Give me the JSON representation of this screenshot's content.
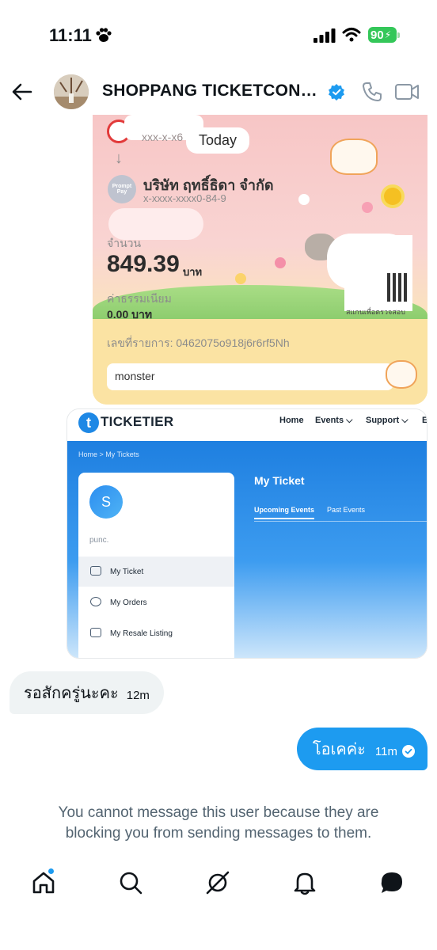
{
  "status_bar": {
    "time": "11:11",
    "battery": "90"
  },
  "header": {
    "name": "SHOPPANG TICKETCONCE..."
  },
  "slip": {
    "today": "Today",
    "account_from": "xxx-x-x6",
    "recipient": "บริษัท ฤทธิ์ธิดา จำกัด",
    "account_to": "x-xxxx-xxxx0-84-9",
    "promptpay": "Prompt Pay",
    "amount_label": "จำนวน",
    "amount": "849.39",
    "currency": "บาท",
    "fee_label": "ค่าธรรมเนียม",
    "fee": "0.00 บาท",
    "ref": "เลขที่รายการ: 0462075o918j6r6rf5Nh",
    "memo": "monster",
    "qr_caption": "สแกนเพื่อตรวจสอบ"
  },
  "ticket": {
    "brand": "TICKETIER",
    "logo_letter": "t",
    "nav": [
      "Home",
      "Events ⌵",
      "Support ⌵",
      "E"
    ],
    "breadcrumb": "Home  >  My Tickets",
    "avatar_letter": "S",
    "username": "punc.",
    "menu": [
      "My Ticket",
      "My Orders",
      "My Resale Listing"
    ],
    "title": "My Ticket",
    "tabs": [
      "Upcoming Events",
      "Past Events"
    ]
  },
  "messages": {
    "incoming": {
      "text": "รอสักครู่นะคะ",
      "time": "12m"
    },
    "outgoing": {
      "text": "โอเคค่ะ",
      "time": "11m"
    }
  },
  "blocked_notice": "You cannot message this user because they are blocking you from sending messages to them.",
  "colors": {
    "accent": "#1d9bf0",
    "incoming_bubble": "#eff3f4",
    "verified": "#1d9bf0",
    "battery": "#34c759",
    "muted_text": "#536471"
  },
  "icons": [
    "paw-icon",
    "signal-icon",
    "wifi-icon",
    "back-arrow-icon",
    "verified-badge-icon",
    "phone-icon",
    "video-icon",
    "read-check-icon",
    "home-icon",
    "search-icon",
    "grok-icon",
    "bell-icon",
    "messages-icon"
  ]
}
